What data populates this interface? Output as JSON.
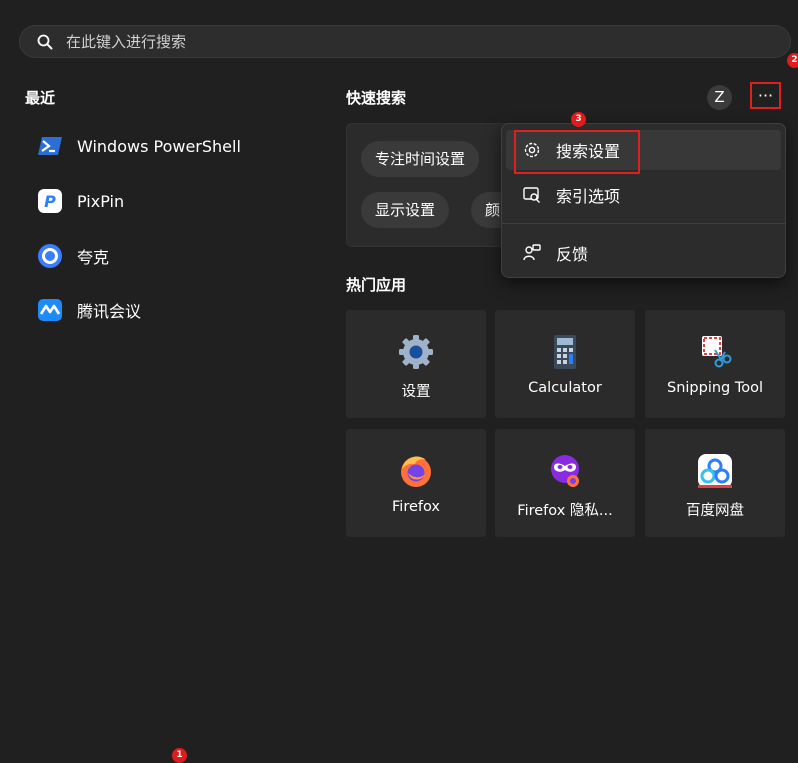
{
  "search": {
    "placeholder": "在此键入进行搜索"
  },
  "recent": {
    "title": "最近",
    "items": [
      {
        "label": "Windows PowerShell",
        "icon": "powershell-icon"
      },
      {
        "label": "PixPin",
        "icon": "pixpin-icon"
      },
      {
        "label": "夸克",
        "icon": "quark-icon"
      },
      {
        "label": "腾讯会议",
        "icon": "tencent-meeting-icon"
      }
    ]
  },
  "quick_search": {
    "title": "快速搜索",
    "chips": [
      {
        "label": "专注时间设置"
      },
      {
        "label": "显示设置"
      },
      {
        "label": "颜"
      }
    ]
  },
  "header": {
    "avatar_letter": "Z",
    "more_label": "···"
  },
  "menu": {
    "items": [
      {
        "label": "搜索设置",
        "icon": "gear-icon"
      },
      {
        "label": "索引选项",
        "icon": "index-options-icon"
      },
      {
        "label": "反馈",
        "icon": "feedback-icon"
      }
    ]
  },
  "apps": {
    "title": "热门应用",
    "items": [
      {
        "label": "设置",
        "icon": "settings-gear-icon"
      },
      {
        "label": "Calculator",
        "icon": "calculator-icon"
      },
      {
        "label": "Snipping Tool",
        "icon": "snipping-tool-icon"
      },
      {
        "label": "Firefox",
        "icon": "firefox-icon"
      },
      {
        "label": "Firefox 隐私...",
        "icon": "firefox-private-icon"
      },
      {
        "label": "百度网盘",
        "icon": "baidu-netdisk-icon"
      }
    ]
  },
  "badges": [
    "1",
    "2",
    "3"
  ],
  "colors": {
    "background": "#202020",
    "highlight": "#e02020",
    "accent_blue": "#2d7ff9"
  }
}
